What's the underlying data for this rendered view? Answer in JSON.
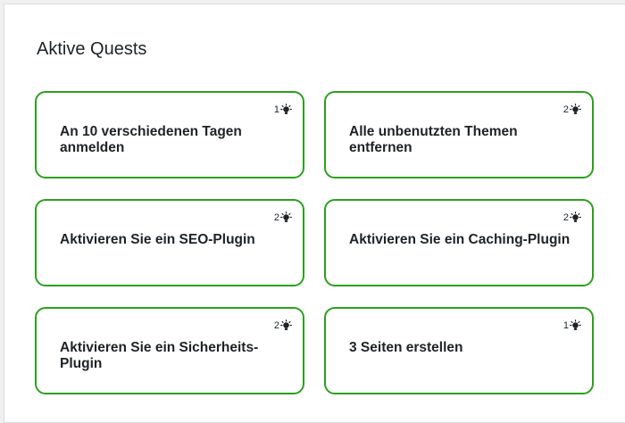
{
  "panel": {
    "title": "Aktive Quests"
  },
  "quests": [
    {
      "label": "An 10 verschiedenen Tagen anmelden",
      "points": "1",
      "icon": "lightbulb-icon"
    },
    {
      "label": "Alle unbenutzten Themen entfernen",
      "points": "2",
      "icon": "lightbulb-icon"
    },
    {
      "label": "Aktivieren Sie ein SEO-Plugin",
      "points": "2",
      "icon": "lightbulb-icon"
    },
    {
      "label": "Aktivieren Sie ein Caching-Plugin",
      "points": "2",
      "icon": "lightbulb-icon"
    },
    {
      "label": "Aktivieren Sie ein Sicherheits-Plugin",
      "points": "2",
      "icon": "lightbulb-icon"
    },
    {
      "label": "3 Seiten erstellen",
      "points": "1",
      "icon": "lightbulb-icon"
    }
  ],
  "colors": {
    "card_border": "#2ba01d",
    "text": "#1d2327",
    "background": "#f0f0f1"
  }
}
